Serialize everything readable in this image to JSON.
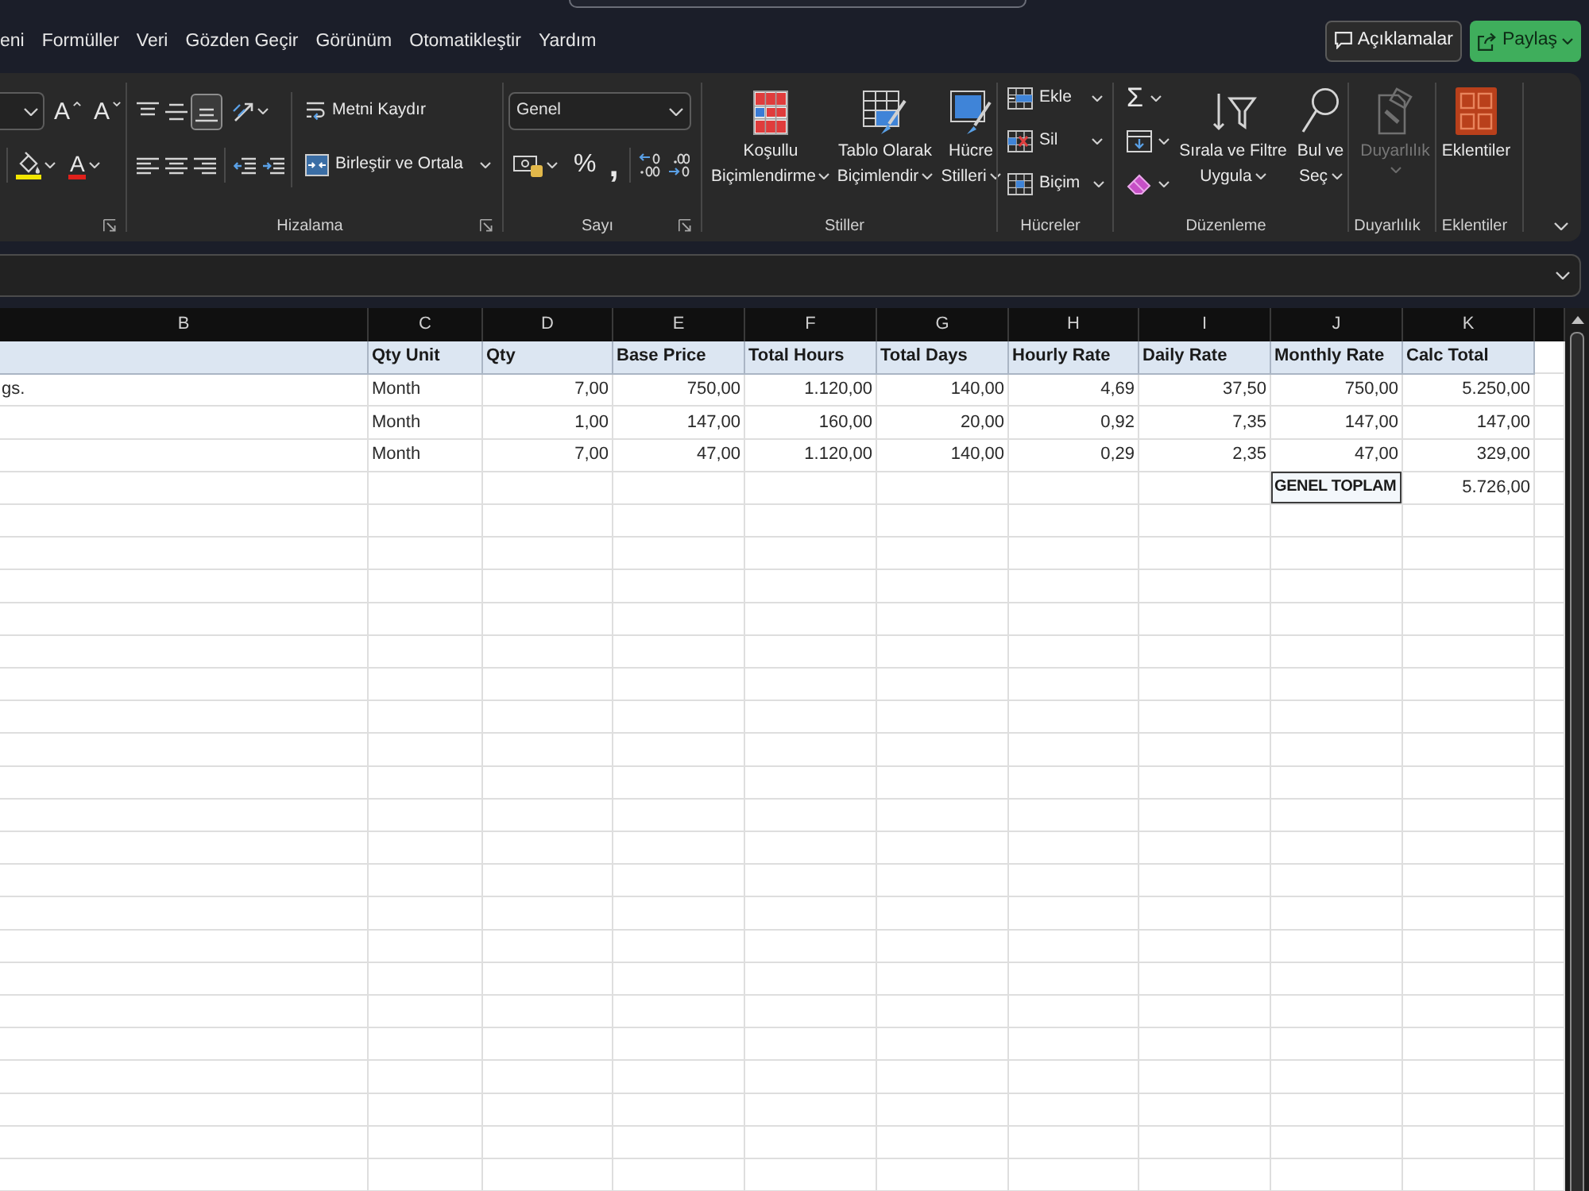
{
  "menu_tabs": [
    {
      "label": "eni",
      "selected": false
    },
    {
      "label": "Formüller",
      "selected": false
    },
    {
      "label": "Veri",
      "selected": false
    },
    {
      "label": "Gözden Geçir",
      "selected": false
    },
    {
      "label": "Görünüm",
      "selected": false
    },
    {
      "label": "Otomatikleştir",
      "selected": false
    },
    {
      "label": "Yardım",
      "selected": false
    }
  ],
  "comments_button": {
    "label": "Açıklamalar"
  },
  "share_button": {
    "label": "Paylaş"
  },
  "ribbon": {
    "font": {
      "grow_glyph": "A",
      "shrink_glyph": "A",
      "font_color_glyph": "A"
    },
    "alignment": {
      "label": "Hizalama",
      "vertical": [
        {
          "selected": false
        },
        {
          "selected": false
        },
        {
          "selected": true
        }
      ],
      "horizontal": [
        {
          "selected": false
        },
        {
          "selected": false
        },
        {
          "selected": false
        }
      ],
      "wrap_text": "Metni Kaydır",
      "merge": "Birleştir ve Ortala"
    },
    "number": {
      "label": "Sayı",
      "format": "Genel",
      "percent_glyph": "%",
      "comma_glyph": ","
    },
    "styles": {
      "label": "Stiller",
      "buttons": [
        "Koşullu Biçimlendirme",
        "Tablo Olarak Biçimlendir",
        "Hücre Stilleri"
      ]
    },
    "cells": {
      "label": "Hücreler",
      "buttons": [
        "Ekle",
        "Sil",
        "Biçim"
      ]
    },
    "editing": {
      "label": "Düzenleme",
      "autosum_glyph": "Σ",
      "buttons": [
        "Sırala ve Filtre Uygula",
        "Bul ve Seç"
      ]
    },
    "sensitivity": {
      "label": "Duyarlılık",
      "button": "Duyarlılık",
      "disabled": true
    },
    "addins": {
      "label": "Eklentiler",
      "button": "Eklentiler"
    }
  },
  "sheet": {
    "columns": [
      "B",
      "C",
      "D",
      "E",
      "F",
      "G",
      "H",
      "I",
      "J",
      "K"
    ],
    "rows": [
      {
        "kind": "header",
        "cells": [
          null,
          "Qty Unit",
          "Qty",
          "Base Price",
          "Total Hours",
          "Total Days",
          "Hourly Rate",
          "Daily Rate",
          "Monthly Rate",
          "Calc Total"
        ]
      },
      {
        "kind": "data",
        "cells": [
          "gs.",
          "Month",
          "7,00",
          "750,00",
          "1.120,00",
          "140,00",
          "4,69",
          "37,50",
          "750,00",
          "5.250,00"
        ]
      },
      {
        "kind": "data",
        "cells": [
          null,
          "Month",
          "1,00",
          "147,00",
          "160,00",
          "20,00",
          "0,92",
          "7,35",
          "147,00",
          "147,00"
        ]
      },
      {
        "kind": "data",
        "cells": [
          null,
          "Month",
          "7,00",
          "47,00",
          "1.120,00",
          "140,00",
          "0,29",
          "2,35",
          "47,00",
          "329,00"
        ]
      },
      {
        "kind": "total",
        "cells": [
          null,
          null,
          null,
          null,
          null,
          null,
          null,
          null,
          "GENEL TOPLAM",
          "5.726,00"
        ]
      }
    ]
  }
}
